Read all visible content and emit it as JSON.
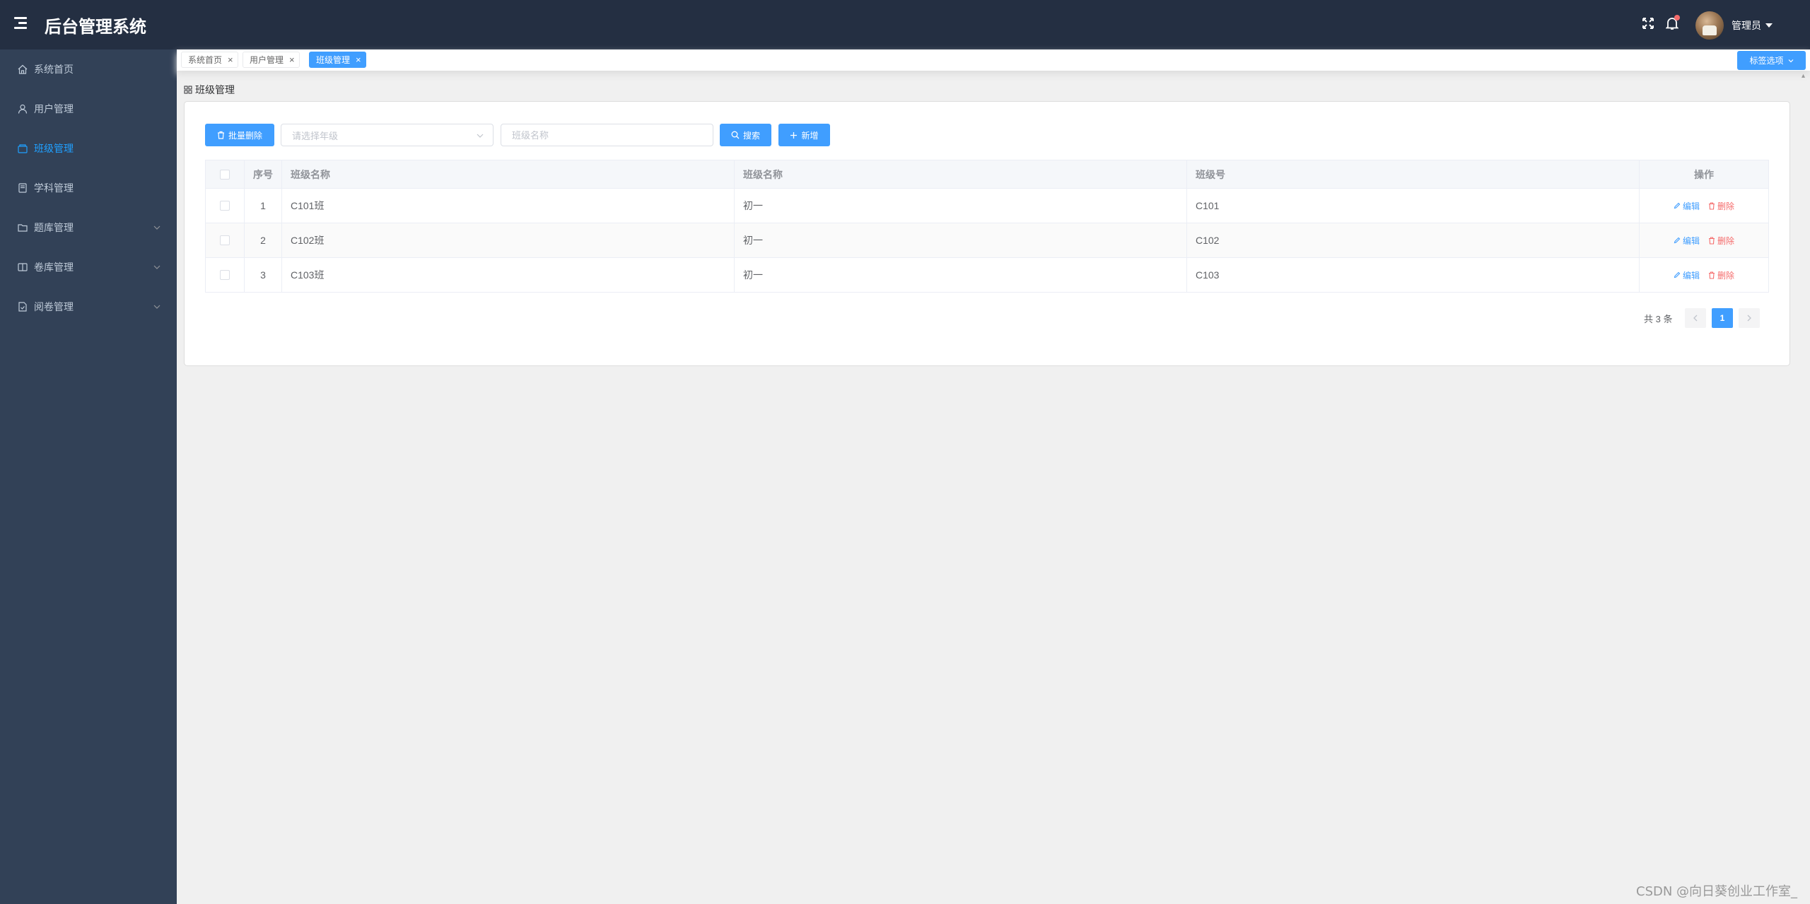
{
  "header": {
    "title": "后台管理系统",
    "user": "管理员"
  },
  "sidebar": {
    "items": [
      {
        "label": "系统首页",
        "icon": "home-icon"
      },
      {
        "label": "用户管理",
        "icon": "user-icon"
      },
      {
        "label": "班级管理",
        "icon": "class-icon",
        "active": true
      },
      {
        "label": "学科管理",
        "icon": "book-icon"
      },
      {
        "label": "题库管理",
        "icon": "folder-icon",
        "expandable": true
      },
      {
        "label": "卷库管理",
        "icon": "reader-icon",
        "expandable": true
      },
      {
        "label": "阅卷管理",
        "icon": "document-icon",
        "expandable": true
      }
    ]
  },
  "tags": {
    "items": [
      "系统首页",
      "用户管理",
      "班级管理"
    ],
    "active": "班级管理",
    "options_label": "标签选项"
  },
  "crumbs": {
    "label": "班级管理"
  },
  "toolbar": {
    "batch_delete_label": "批量删除",
    "grade_placeholder": "请选择年级",
    "class_name_placeholder": "班级名称",
    "search_label": "搜索",
    "add_label": "新增"
  },
  "table": {
    "columns": [
      "序号",
      "班级名称",
      "班级名称",
      "班级号",
      "操作"
    ],
    "rows": [
      {
        "index": "1",
        "name": "C101班",
        "grade": "初一",
        "code": "C101"
      },
      {
        "index": "2",
        "name": "C102班",
        "grade": "初一",
        "code": "C102"
      },
      {
        "index": "3",
        "name": "C103班",
        "grade": "初一",
        "code": "C103"
      }
    ],
    "edit_label": "编辑",
    "delete_label": "删除"
  },
  "pagination": {
    "total_text": "共 3 条",
    "current_page": "1"
  },
  "watermark": "CSDN @向日葵创业工作室_",
  "colors": {
    "header_bg": "#242f42",
    "sidebar_bg": "#324157",
    "sidebar_text": "#bfcbd9",
    "sidebar_active": "#20a0ff",
    "primary": "#409eff",
    "danger": "#f56c6c"
  }
}
